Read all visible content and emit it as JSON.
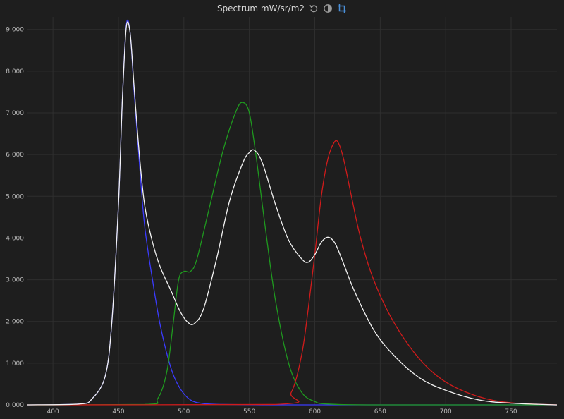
{
  "header": {
    "title": "Spectrum mW/sr/m2",
    "icons": [
      "reset-icon",
      "contrast-icon",
      "crop-icon"
    ]
  },
  "colors": {
    "background": "#1e1e1e",
    "grid": "#2f2f2f",
    "blue": "#3b3bff",
    "green": "#1f9a1f",
    "red": "#d11b1b",
    "white": "#f2f2f2",
    "accent": "#4a90d9"
  },
  "chart_data": {
    "type": "line",
    "title": "Spectrum mW/sr/m2",
    "xlabel": "",
    "ylabel": "",
    "xlim": [
      380,
      785
    ],
    "ylim": [
      0,
      9.3
    ],
    "x_ticks": [
      "400",
      "450",
      "500",
      "550",
      "600",
      "650",
      "700",
      "750"
    ],
    "y_ticks": [
      "0.000",
      "1.000",
      "2.000",
      "3.000",
      "4.000",
      "5.000",
      "6.000",
      "7.000",
      "8.000",
      "9.000"
    ],
    "grid": true,
    "series": [
      {
        "color": "#3b3bff",
        "x": [
          380,
          420,
          430,
          440,
          445,
          450,
          453,
          456,
          459,
          462,
          466,
          470,
          476,
          482,
          490,
          497,
          505,
          515,
          530,
          560,
          600,
          650,
          700,
          785
        ],
        "y": [
          0.0,
          0.02,
          0.15,
          0.7,
          2.0,
          4.8,
          7.3,
          9.1,
          8.9,
          7.5,
          5.8,
          4.3,
          3.0,
          1.9,
          0.9,
          0.4,
          0.12,
          0.03,
          0.01,
          0.0,
          0.0,
          0.0,
          0.0,
          0.0
        ]
      },
      {
        "color": "#1f9a1f",
        "x": [
          380,
          470,
          480,
          487,
          492,
          496,
          500,
          505,
          510,
          520,
          530,
          540,
          545,
          550,
          555,
          562,
          570,
          580,
          590,
          600,
          610,
          650,
          785
        ],
        "y": [
          0.0,
          0.01,
          0.15,
          0.8,
          2.0,
          3.0,
          3.2,
          3.2,
          3.5,
          4.8,
          6.1,
          7.05,
          7.25,
          7.0,
          6.0,
          4.3,
          2.5,
          1.0,
          0.3,
          0.08,
          0.02,
          0.0,
          0.0
        ]
      },
      {
        "color": "#d11b1b",
        "x": [
          380,
          570,
          582,
          590,
          595,
          600,
          605,
          610,
          615,
          618,
          622,
          628,
          635,
          645,
          660,
          680,
          700,
          725,
          750,
          785
        ],
        "y": [
          0.0,
          0.01,
          0.3,
          1.2,
          2.3,
          3.6,
          5.0,
          5.9,
          6.3,
          6.28,
          5.9,
          5.0,
          4.0,
          3.0,
          2.0,
          1.1,
          0.55,
          0.2,
          0.05,
          0.0
        ]
      },
      {
        "color": "#f2f2f2",
        "x": [
          380,
          420,
          430,
          440,
          445,
          450,
          453,
          456,
          459,
          462,
          466,
          470,
          476,
          482,
          490,
          497,
          503,
          508,
          515,
          525,
          535,
          545,
          550,
          554,
          560,
          570,
          580,
          590,
          595,
          600,
          605,
          610,
          615,
          620,
          630,
          645,
          660,
          680,
          700,
          725,
          750,
          785
        ],
        "y": [
          0.0,
          0.02,
          0.15,
          0.7,
          2.0,
          4.8,
          7.3,
          9.05,
          8.9,
          7.6,
          6.0,
          4.8,
          3.9,
          3.3,
          2.75,
          2.25,
          1.98,
          1.95,
          2.3,
          3.5,
          4.9,
          5.8,
          6.05,
          6.1,
          5.8,
          4.8,
          3.95,
          3.5,
          3.42,
          3.6,
          3.9,
          4.02,
          3.9,
          3.55,
          2.75,
          1.8,
          1.2,
          0.65,
          0.35,
          0.12,
          0.04,
          0.0
        ]
      }
    ]
  }
}
